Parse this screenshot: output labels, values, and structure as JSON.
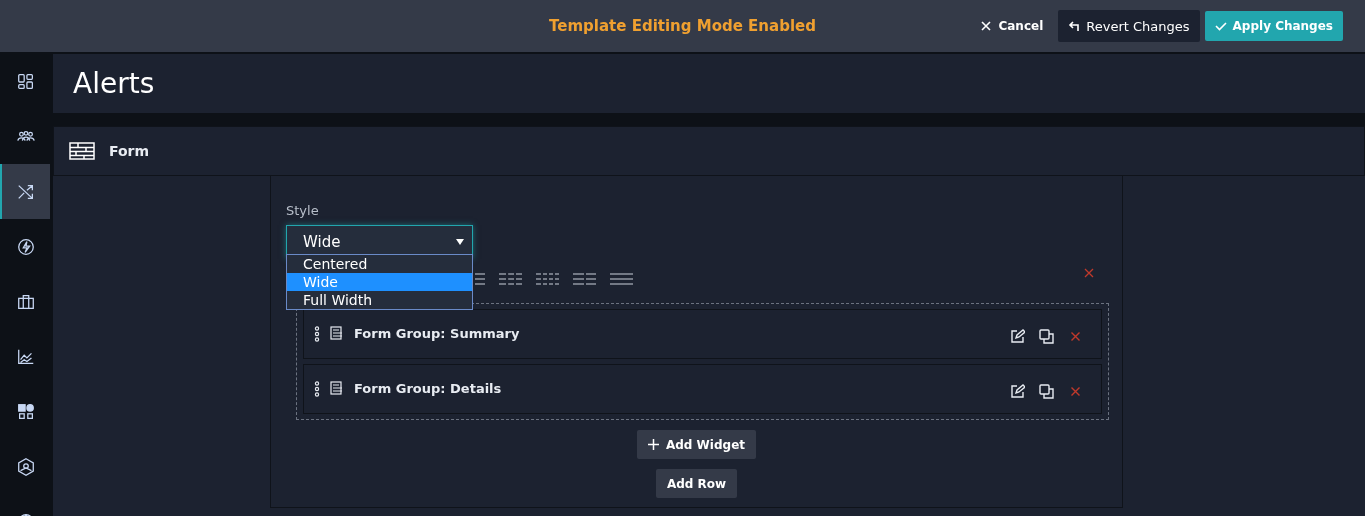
{
  "top_bar": {
    "mode_text": "Template Editing Mode Enabled",
    "buttons": [
      {
        "label": "Cancel",
        "kind": "cancel"
      },
      {
        "label": "Revert Changes",
        "kind": "revert"
      },
      {
        "label": "Apply Changes",
        "kind": "apply"
      }
    ]
  },
  "sidebar": {
    "items": [
      {
        "selected": false
      },
      {
        "selected": false
      },
      {
        "selected": true
      },
      {
        "selected": false
      },
      {
        "selected": false
      },
      {
        "selected": false
      },
      {
        "selected": false
      },
      {
        "selected": false
      },
      {
        "selected": false
      }
    ]
  },
  "page_title": "Alerts",
  "section": {
    "title": "Form"
  },
  "style_field": {
    "label": "Style",
    "value": "Wide",
    "expanded": true,
    "options": [
      {
        "label": "Centered",
        "selected": false
      },
      {
        "label": "Wide",
        "selected": true
      },
      {
        "label": "Full Width",
        "selected": false
      }
    ]
  },
  "widgets": [
    {
      "title": "Form Group: Summary"
    },
    {
      "title": "Form Group: Details"
    }
  ],
  "add_widget": "Add Widget",
  "add_row": "Add Row"
}
